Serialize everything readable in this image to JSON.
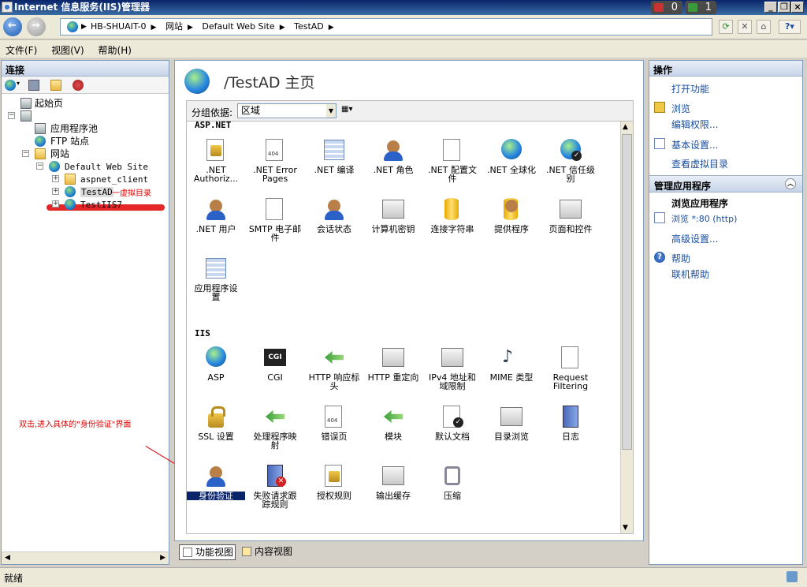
{
  "window": {
    "title": "Internet 信息服务(IIS)管理器",
    "badge_red_count": "0",
    "badge_green_count": "1",
    "badge_red_color": "#c83232",
    "badge_green_color": "#3a9a3a"
  },
  "address": {
    "crumbs": [
      "HB-SHUAIT-0",
      "网站",
      "Default Web Site",
      "TestAD"
    ]
  },
  "menu": {
    "file": "文件(F)",
    "view": "视图(V)",
    "help": "帮助(H)"
  },
  "left": {
    "header": "连接",
    "tree": {
      "start_page": "起始页",
      "app_pools": "应用程序池",
      "ftp_sites": "FTP 站点",
      "sites": "网站",
      "default_site": "Default Web Site",
      "aspnet_client": "aspnet_client",
      "testad": "TestAD",
      "testiis7": "TestIIS7"
    },
    "annotation_virtual_dir": "一虚拟目录",
    "annotation_instruction": "双击,进入具体的\"身份验证\"界面"
  },
  "center": {
    "page_title": "/TestAD 主页",
    "group_by_label": "分组依据:",
    "group_by_value": "区域",
    "sections": {
      "aspnet": "ASP.NET",
      "iis": "IIS"
    },
    "aspnet_features": [
      [
        ".NET",
        "Authoriz..."
      ],
      [
        ".NET Error",
        "Pages"
      ],
      [
        ".NET 编译"
      ],
      [
        ".NET 角色"
      ],
      [
        ".NET 配置文",
        "件"
      ],
      [
        ".NET 全球化"
      ],
      [
        ".NET 信任级",
        "别"
      ],
      [
        ".NET 用户"
      ],
      [
        "SMTP 电子邮",
        "件"
      ],
      [
        "会话状态"
      ],
      [
        "计算机密钥"
      ],
      [
        "连接字符串"
      ],
      [
        "提供程序"
      ],
      [
        "页面和控件"
      ],
      [
        "应用程序设",
        "置"
      ]
    ],
    "iis_features": [
      [
        "ASP"
      ],
      [
        "CGI"
      ],
      [
        "HTTP 响应标",
        "头"
      ],
      [
        "HTTP 重定向"
      ],
      [
        "IPv4 地址和",
        "域限制"
      ],
      [
        "MIME 类型"
      ],
      [
        "Request",
        "Filtering"
      ],
      [
        "SSL 设置"
      ],
      [
        "处理程序映",
        "射"
      ],
      [
        "错误页"
      ],
      [
        "模块"
      ],
      [
        "默认文档"
      ],
      [
        "目录浏览"
      ],
      [
        "日志"
      ],
      [
        "身份验证"
      ],
      [
        "失败请求跟",
        "踪规则"
      ],
      [
        "授权规则"
      ],
      [
        "输出缓存"
      ],
      [
        "压缩"
      ]
    ],
    "cgi_icon_text": "CGI",
    "error_icon_text": "404"
  },
  "bottom_tabs": {
    "feature_view": "功能视图",
    "content_view": "内容视图"
  },
  "right": {
    "header": "操作",
    "open_feature": "打开功能",
    "browse": "浏览",
    "edit_permissions": "编辑权限...",
    "basic_settings": "基本设置...",
    "view_virtual_dirs": "查看虚拟目录",
    "manage_app_header": "管理应用程序",
    "browse_app": "浏览应用程序",
    "browse_80": "浏览 *:80 (http)",
    "advanced_settings": "高级设置...",
    "help": "帮助",
    "online_help": "联机帮助"
  },
  "status": {
    "text": "就绪"
  }
}
